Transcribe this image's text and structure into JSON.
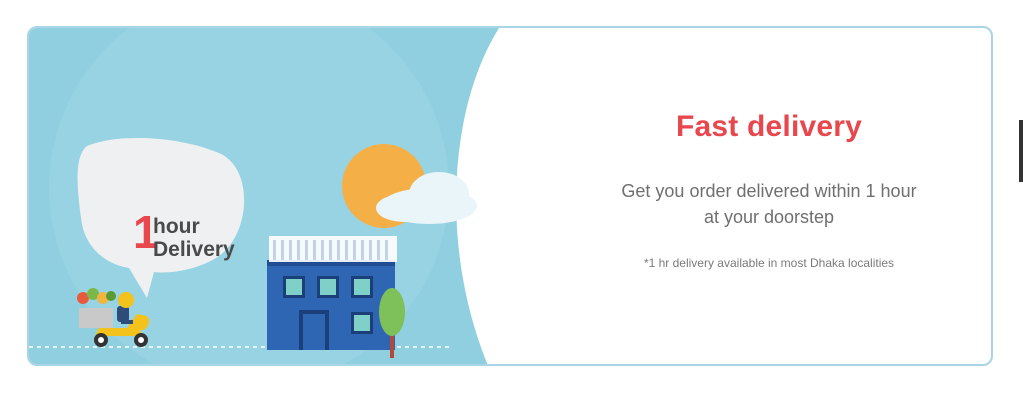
{
  "banner": {
    "title": "Fast delivery",
    "subtitle_line1": "Get you order delivered within 1 hour",
    "subtitle_line2": "at your doorstep",
    "note": "*1 hr delivery available in most Dhaka localities"
  },
  "bubble": {
    "number": "1",
    "line1": "hour",
    "line2": "Delivery"
  },
  "colors": {
    "accent": "#e7474d",
    "sky": "#8fcfe0",
    "building": "#2f66b3",
    "sun": "#f4b047",
    "scooter": "#f3c21c",
    "tree": "#7ec15a"
  }
}
